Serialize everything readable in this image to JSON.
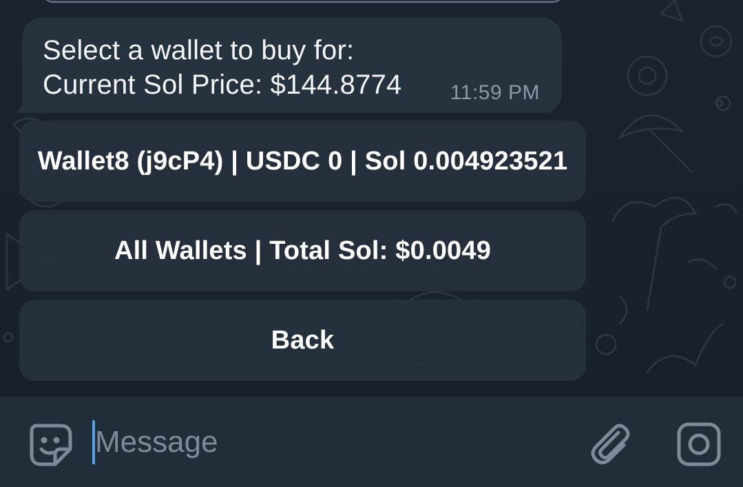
{
  "chat": {
    "message": {
      "line1": "Select a wallet to buy for:",
      "line2": "Current Sol Price: $144.8774",
      "time": "11:59 PM"
    },
    "buttons": [
      {
        "label": "Wallet8 (j9cP4) | USDC 0 | Sol 0.004923521"
      },
      {
        "label": "All Wallets | Total Sol: $0.0049"
      },
      {
        "label": "Back"
      }
    ]
  },
  "composer": {
    "placeholder": "Message",
    "emoji_icon": "sticker-smile-icon",
    "attach_icon": "paperclip-icon",
    "camera_icon": "camera-icon"
  },
  "colors": {
    "background": "#18212c",
    "bubble": "#27323f",
    "button": "#26313e",
    "input_bar": "#222d3a",
    "cursor": "#5aa0e6",
    "icon": "#7d8a98"
  }
}
